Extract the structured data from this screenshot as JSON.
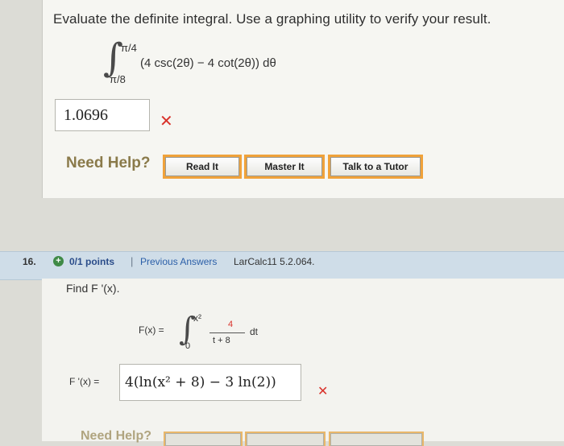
{
  "problem15": {
    "prompt": "Evaluate the definite integral. Use a graphing utility to verify your result.",
    "upper_limit": "π/4",
    "lower_limit": "π/8",
    "integrand": "(4 csc(2θ) − 4 cot(2θ)) dθ",
    "answer_value": "1.0696",
    "status_mark": "✕",
    "need_help": "Need Help?",
    "buttons": [
      "Read It",
      "Master It",
      "Talk to a Tutor"
    ]
  },
  "problem16": {
    "number": "16.",
    "points": "0/1 points",
    "separator": "|",
    "previous_answers": "Previous Answers",
    "reference": "LarCalc11 5.2.064.",
    "prompt": "Find F '(x).",
    "definition_lhs": "F(x) =",
    "upper_limit": "x²",
    "lower_limit": "0",
    "numerator": "4",
    "denominator": "t + 8",
    "differential": "dt",
    "answer_label": "F '(x) =",
    "answer_value": "4(ln(x² + 8) − 3 ln(2))",
    "status_mark": "✕",
    "need_help": "Need Help?"
  },
  "colors": {
    "wrong_mark": "#d9322b",
    "link_blue": "#2b5fa8",
    "button_outline": "#f0a23a",
    "question_bar": "#cfdde8"
  }
}
